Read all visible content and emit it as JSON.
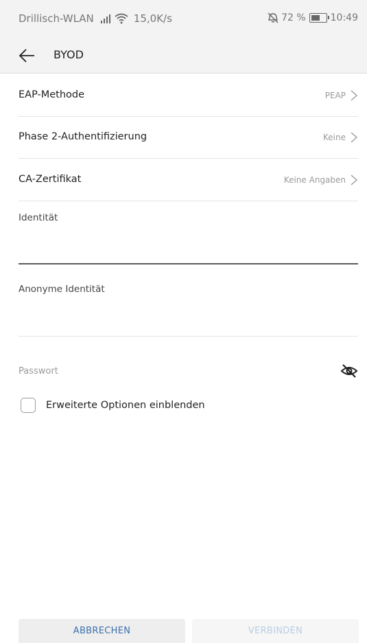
{
  "status_bar": {
    "carrier": "Drillisch-WLAN",
    "speed": "15,0K/s",
    "battery_percent": "72 %",
    "time": "10:49",
    "icons": [
      "signal-icon",
      "wifi-icon",
      "mute-icon",
      "battery-icon"
    ]
  },
  "header": {
    "title": "BYOD",
    "back_icon": "arrow-left-icon"
  },
  "settings": [
    {
      "label": "EAP-Methode",
      "value": "PEAP"
    },
    {
      "label": "Phase 2-Authentifizierung",
      "value": "Keine"
    },
    {
      "label": "CA-Zertifikat",
      "value": "Keine Angaben"
    }
  ],
  "fields": {
    "identity": {
      "label": "Identität",
      "value": ""
    },
    "anonymous_identity": {
      "label": "Anonyme Identität",
      "value": ""
    },
    "password": {
      "label": "Passwort",
      "value": "",
      "toggle_icon": "eye-off-icon"
    }
  },
  "advanced_options": {
    "label": "Erweiterte Optionen einblenden",
    "checked": false
  },
  "buttons": {
    "cancel": "ABBRECHEN",
    "connect": "VERBINDEN"
  },
  "colors": {
    "accent": "#3a6fb0",
    "disabled": "#b9cde4",
    "header_bg": "#f3f3f3"
  }
}
